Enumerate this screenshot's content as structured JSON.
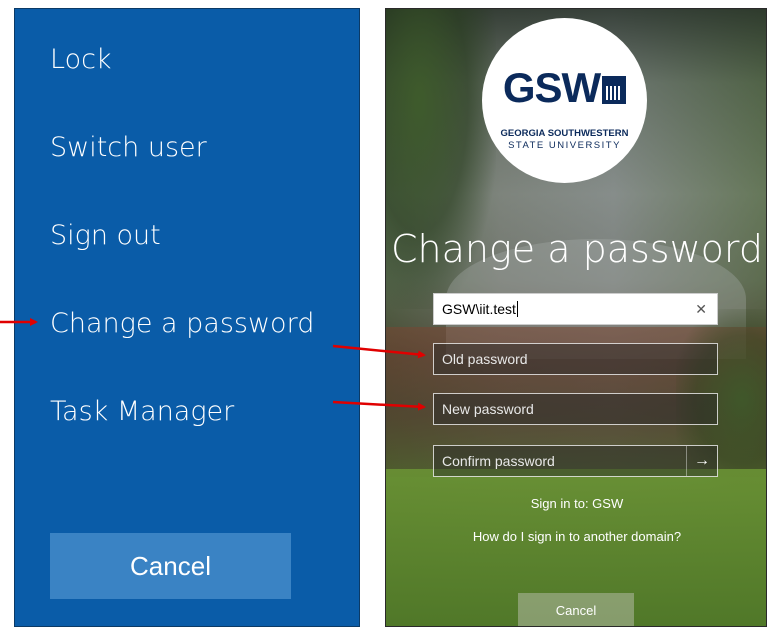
{
  "left_menu": {
    "items": [
      {
        "label": "Lock"
      },
      {
        "label": "Switch user"
      },
      {
        "label": "Sign out"
      },
      {
        "label": "Change a password"
      },
      {
        "label": "Task Manager"
      }
    ],
    "cancel_label": "Cancel"
  },
  "change_password": {
    "logo": {
      "wordmark": "GSW",
      "line1": "GEORGIA SOUTHWESTERN",
      "line2": "STATE UNIVERSITY"
    },
    "title": "Change a password",
    "username_value": "GSW\\iit.test",
    "old_password_placeholder": "Old password",
    "new_password_placeholder": "New password",
    "confirm_password_placeholder": "Confirm password",
    "sign_in_to": "Sign in to: GSW",
    "domain_help_link": "How do I sign in to another domain?",
    "cancel_label": "Cancel"
  },
  "icons": {
    "clear": "close-icon",
    "submit": "arrow-right-icon",
    "logo_building": "building-icon"
  },
  "colors": {
    "left_panel_bg": "#0a5ca8",
    "left_cancel_bg": "#3a83c4",
    "logo_navy": "#0b2a5b",
    "annotation_red": "#e00000"
  }
}
